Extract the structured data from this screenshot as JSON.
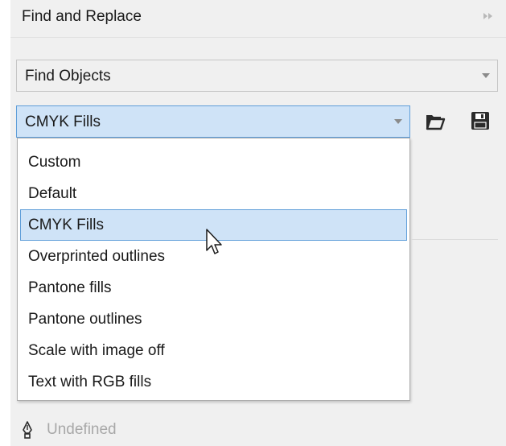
{
  "panel": {
    "title": "Find and Replace",
    "collapse_icon": "double-chevron-right-icon"
  },
  "find_mode": {
    "value": "Find Objects",
    "arrow_icon": "triangle-down-icon"
  },
  "preset": {
    "value": "CMYK Fills",
    "arrow_icon": "triangle-down-icon",
    "open_icon": "folder-open-icon",
    "save_icon": "save-disk-icon"
  },
  "dropdown": {
    "items": [
      {
        "label": "Custom",
        "selected": false
      },
      {
        "label": "Default",
        "selected": false
      },
      {
        "label": "CMYK Fills",
        "selected": true
      },
      {
        "label": "Overprinted outlines",
        "selected": false
      },
      {
        "label": "Pantone fills",
        "selected": false
      },
      {
        "label": "Pantone outlines",
        "selected": false
      },
      {
        "label": "Scale with image off",
        "selected": false
      },
      {
        "label": "Text with RGB fills",
        "selected": false
      }
    ]
  },
  "outline_row": {
    "icon": "pen-nib-icon",
    "label": "Undefined"
  },
  "colors": {
    "panel_bg": "#f0f0f0",
    "selection_bg": "#cfe3f7",
    "selection_border": "#5f9ed9",
    "disabled_text": "#a8a8a8"
  }
}
